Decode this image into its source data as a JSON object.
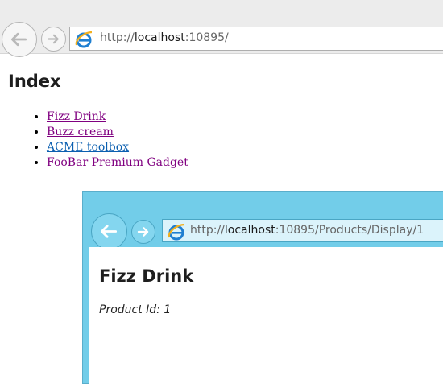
{
  "outer_browser": {
    "address": {
      "host_prefix": "http://",
      "host": "localhost",
      "rest": ":10895/"
    },
    "icons": {
      "back": "back-arrow-icon",
      "forward": "forward-arrow-icon",
      "site": "ie-icon"
    }
  },
  "index_page": {
    "title": "Index",
    "products": [
      {
        "label": "Fizz Drink",
        "visited": true
      },
      {
        "label": "Buzz cream",
        "visited": true
      },
      {
        "label": "ACME toolbox",
        "visited": false
      },
      {
        "label": "FooBar Premium Gadget",
        "visited": true
      }
    ]
  },
  "inner_browser": {
    "address": {
      "host_prefix": "http://",
      "host": "localhost",
      "rest": ":10895/Products/Display/1"
    },
    "page": {
      "title": "Fizz Drink",
      "product_id_text": "Product Id: 1"
    }
  },
  "colors": {
    "visited_link": "#800080",
    "link": "#0b5fb0",
    "inner_frame": "#72cde9"
  }
}
